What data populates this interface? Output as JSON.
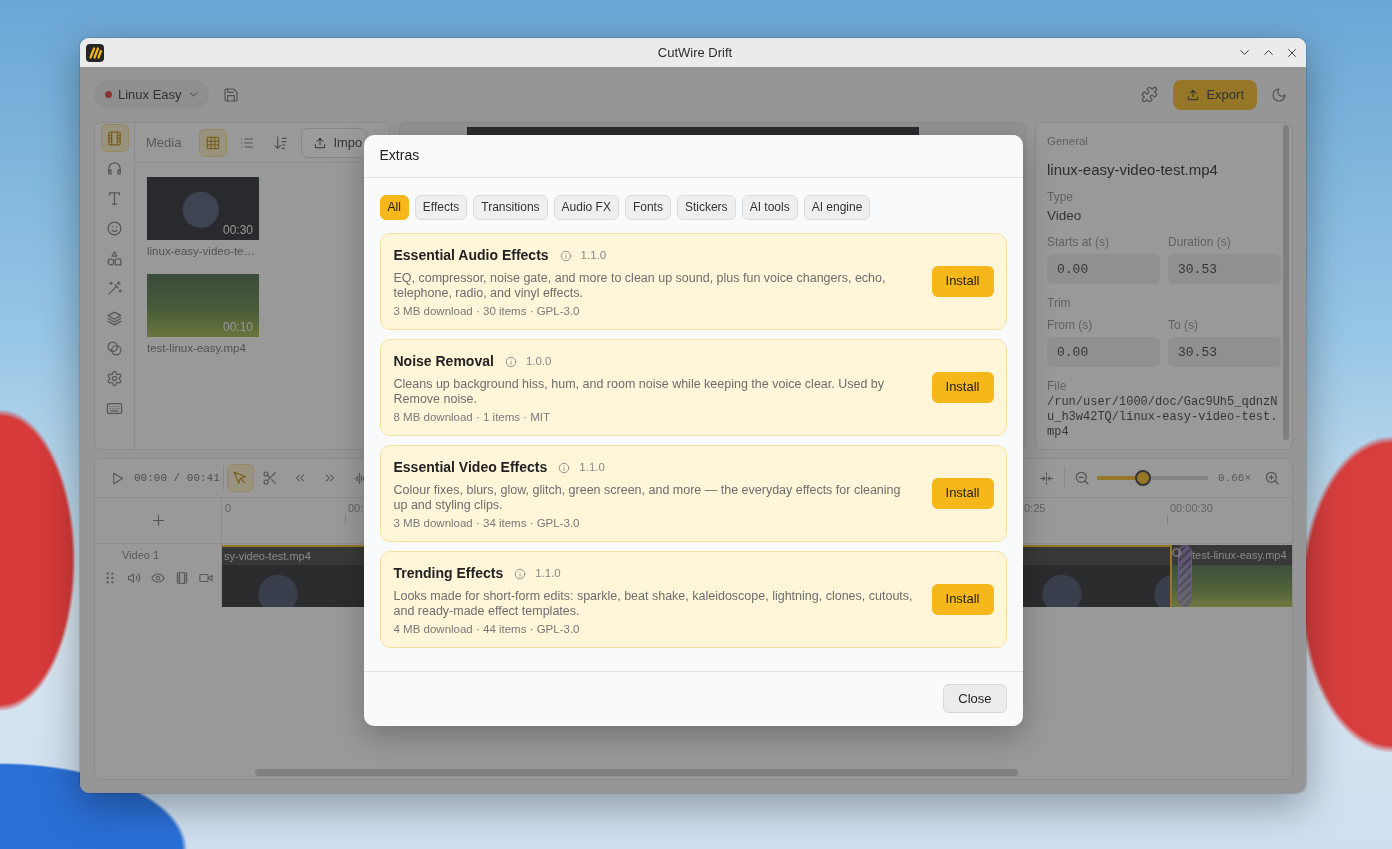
{
  "window": {
    "title": "CutWire Drift"
  },
  "header": {
    "project": {
      "name": "Linux Easy",
      "unsaved": true
    },
    "export_label": "Export"
  },
  "rail": {
    "items": [
      {
        "kind": "film",
        "selected": true
      },
      {
        "kind": "headphones",
        "selected": false
      },
      {
        "kind": "text",
        "selected": false
      },
      {
        "kind": "smiley",
        "selected": false
      },
      {
        "kind": "shapes",
        "selected": false
      },
      {
        "kind": "wand",
        "selected": false
      },
      {
        "kind": "layers",
        "selected": false
      },
      {
        "kind": "circles",
        "selected": false
      },
      {
        "kind": "gear",
        "selected": false
      },
      {
        "kind": "keyboard",
        "selected": false
      }
    ]
  },
  "media": {
    "title": "Media",
    "views": [
      {
        "kind": "grid",
        "selected": true
      },
      {
        "kind": "list",
        "selected": false
      }
    ],
    "import_label": "Impo",
    "items": [
      {
        "name": "linux-easy-video-te…",
        "duration": "00:30",
        "kind": "space"
      },
      {
        "name": "test-linux-easy.mp4",
        "duration": "00:10",
        "kind": "forest"
      }
    ]
  },
  "properties": {
    "section": "General",
    "title": "linux-easy-video-test.mp4",
    "type": {
      "label": "Type",
      "value": "Video"
    },
    "timing": [
      {
        "label": "Starts at (s)",
        "value": "0.00"
      },
      {
        "label": "Duration (s)",
        "value": "30.53"
      }
    ],
    "trim": {
      "label": "Trim",
      "fields": [
        {
          "label": "From (s)",
          "value": "0.00"
        },
        {
          "label": "To (s)",
          "value": "30.53"
        }
      ]
    },
    "file": {
      "label": "File",
      "path": "/run/user/1000/doc/Gac9Uh5_qdnzNu_h3w42TQ/linux-easy-video-test.mp4"
    }
  },
  "timeline": {
    "time": "00:00 / 00:41",
    "tools": [
      {
        "kind": "select",
        "selected": true
      },
      {
        "kind": "cut",
        "selected": false
      }
    ],
    "zoom": {
      "level": 0.4,
      "reading": "0.66×"
    },
    "ruler": [
      "0",
      "00:",
      "0:25",
      "00:00:30"
    ],
    "tracks": [
      {
        "name": "Video 1",
        "clips": [
          {
            "label": "sy-video-test.mp4",
            "kind": "space",
            "selected": true
          },
          {
            "label": "test-linux-easy.mp4",
            "kind": "forest",
            "selected": false
          }
        ]
      }
    ]
  },
  "dialog": {
    "title": "Extras",
    "filters": [
      {
        "label": "All",
        "selected": true
      },
      {
        "label": "Effects",
        "selected": false
      },
      {
        "label": "Transitions",
        "selected": false
      },
      {
        "label": "Audio FX",
        "selected": false
      },
      {
        "label": "Fonts",
        "selected": false
      },
      {
        "label": "Stickers",
        "selected": false
      },
      {
        "label": "AI tools",
        "selected": false
      },
      {
        "label": "AI engine",
        "selected": false
      }
    ],
    "packages": [
      {
        "name": "Essential Audio Effects",
        "version": "1.1.0",
        "description": "EQ, compressor, noise gate, and more to clean up sound, plus fun voice changers, echo, telephone, radio, and vinyl effects.",
        "meta": "3 MB download · 30 items · GPL-3.0",
        "action": "Install"
      },
      {
        "name": "Noise Removal",
        "version": "1.0.0",
        "description": "Cleans up background hiss, hum, and room noise while keeping the voice clear. Used by Remove noise.",
        "meta": "8 MB download · 1 items · MIT",
        "action": "Install"
      },
      {
        "name": "Essential Video Effects",
        "version": "1.1.0",
        "description": "Colour fixes, blurs, glow, glitch, green screen, and more — the everyday effects for cleaning up and styling clips.",
        "meta": "3 MB download · 34 items · GPL-3.0",
        "action": "Install"
      },
      {
        "name": "Trending Effects",
        "version": "1.1.0",
        "description": "Looks made for short-form edits: sparkle, beat shake, kaleidoscope, lightning, clones, cutouts, and ready-made effect templates.",
        "meta": "4 MB download · 44 items · GPL-3.0",
        "action": "Install"
      }
    ],
    "close_label": "Close"
  }
}
